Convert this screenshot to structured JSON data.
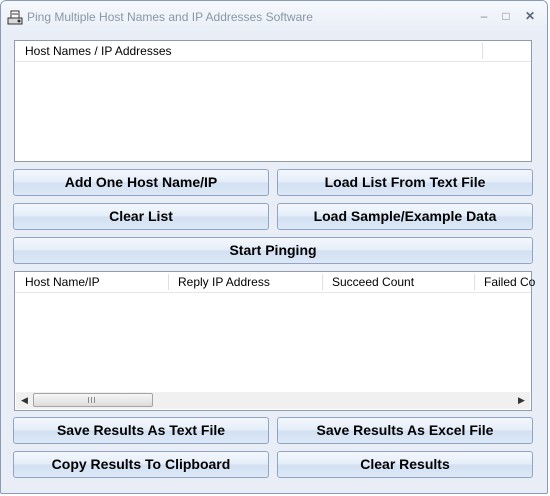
{
  "window": {
    "title": "Ping Multiple Host Names and IP Addresses Software",
    "controls": {
      "minimize": "–",
      "maximize": "□",
      "close": "✕"
    },
    "app_icon": "ping-app-icon"
  },
  "hosts_list": {
    "column": "Host Names / IP Addresses",
    "items": []
  },
  "buttons": {
    "add_one": "Add One Host Name/IP",
    "load_list": "Load List From Text File",
    "clear_list": "Clear List",
    "load_sample": "Load Sample/Example Data",
    "start_pinging": "Start Pinging",
    "save_text": "Save Results As Text File",
    "save_excel": "Save Results As Excel File",
    "copy_clipboard": "Copy Results To Clipboard",
    "clear_results": "Clear Results"
  },
  "results": {
    "columns": [
      "Host Name/IP",
      "Reply IP Address",
      "Succeed Count",
      "Failed Co"
    ],
    "rows": []
  },
  "scrollbar": {
    "left_arrow": "◀",
    "right_arrow": "▶"
  },
  "colors": {
    "window_bg": "#e9eef6",
    "button_border": "#8ea5c6",
    "title_text": "#8a96a6"
  }
}
